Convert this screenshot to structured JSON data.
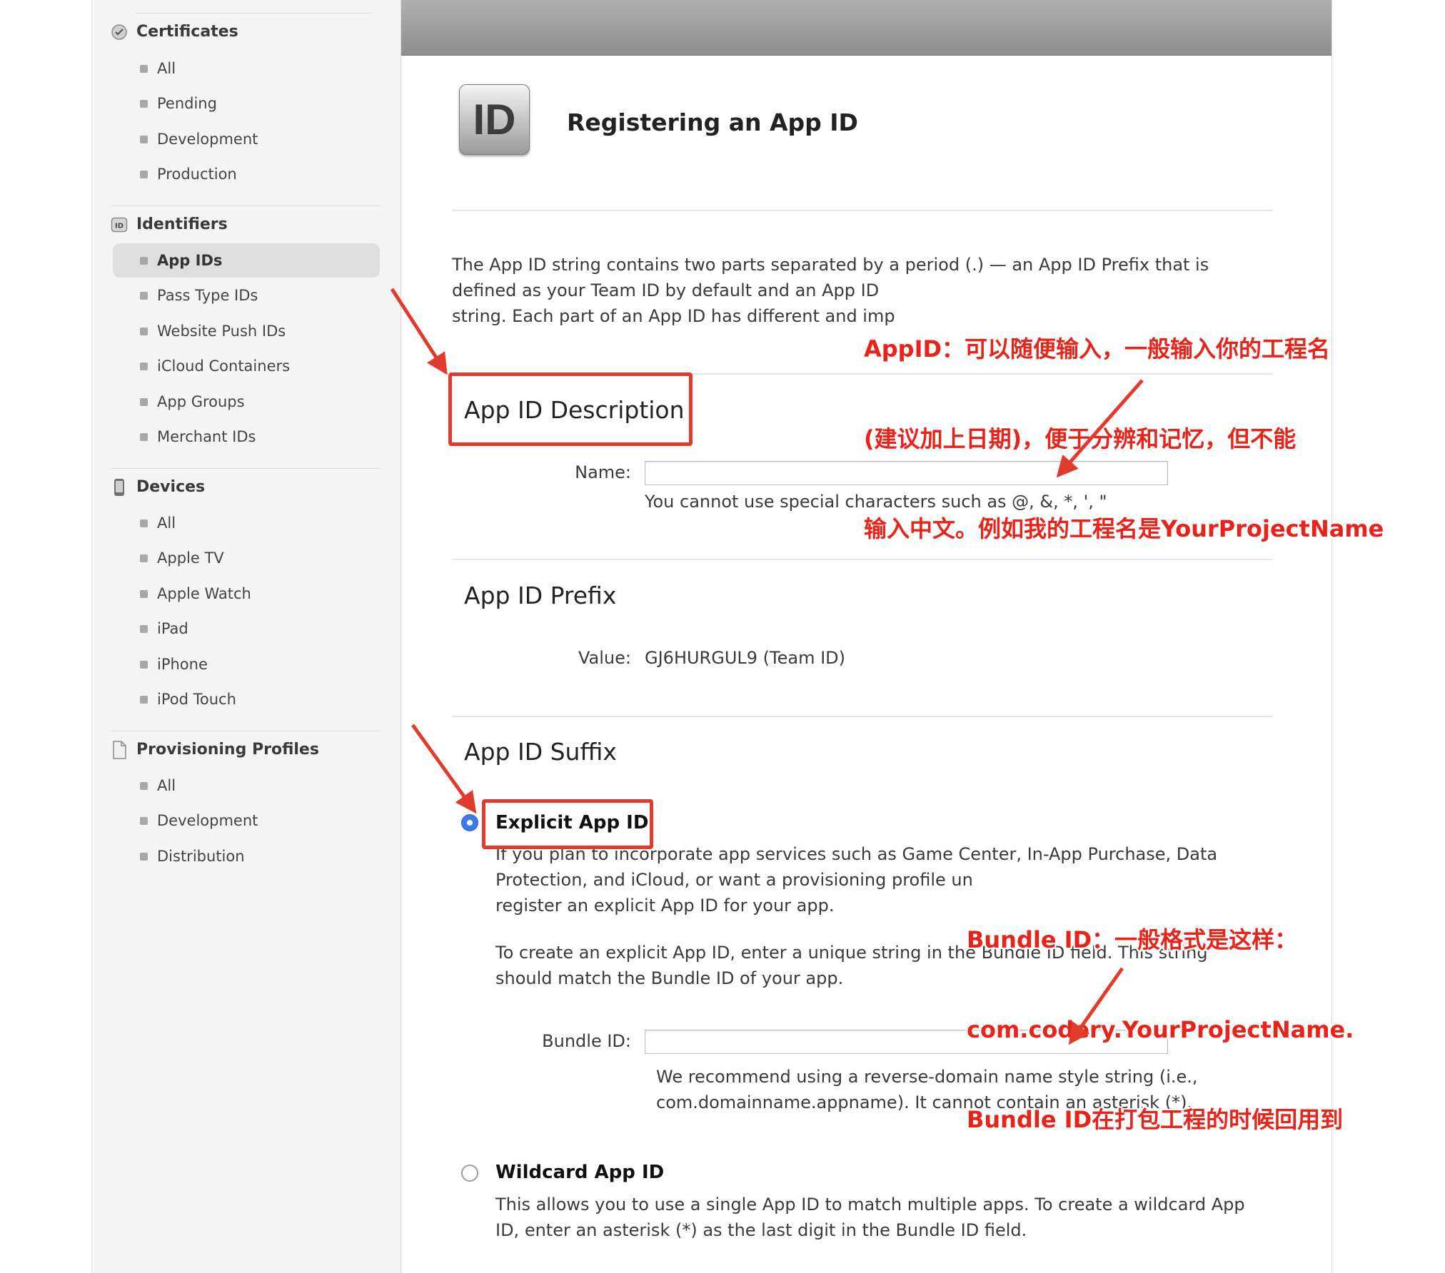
{
  "sidebar": {
    "sections": [
      {
        "title": "Certificates",
        "icon": "certificate-badge-icon",
        "items": [
          "All",
          "Pending",
          "Development",
          "Production"
        ]
      },
      {
        "title": "Identifiers",
        "icon": "id-icon",
        "items": [
          "App IDs",
          "Pass Type IDs",
          "Website Push IDs",
          "iCloud Containers",
          "App Groups",
          "Merchant IDs"
        ],
        "selected": "App IDs"
      },
      {
        "title": "Devices",
        "icon": "device-phone-icon",
        "items": [
          "All",
          "Apple TV",
          "Apple Watch",
          "iPad",
          "iPhone",
          "iPod Touch"
        ]
      },
      {
        "title": "Provisioning Profiles",
        "icon": "document-icon",
        "items": [
          "All",
          "Development",
          "Distribution"
        ]
      }
    ]
  },
  "main": {
    "badge_text": "ID",
    "page_title": "Registering an App ID",
    "intro_lines": [
      "The App ID string contains two parts separated by a period (.) — an App ID Prefix that is",
      "defined as your Team ID by default and an App ID",
      "string. Each part of an App ID has different and imp"
    ],
    "description": {
      "title": "App ID Description",
      "name_label": "Name:",
      "name_value": "",
      "hint": "You cannot use special characters such as @, &, *, ', \""
    },
    "prefix": {
      "title": "App ID Prefix",
      "value_label": "Value:",
      "value": "GJ6HURGUL9 (Team ID)"
    },
    "suffix": {
      "title": "App ID Suffix",
      "explicit": {
        "label": "Explicit App ID",
        "selected": true,
        "desc_lines": [
          "If you plan to incorporate app services such as Game Center, In-App Purchase, Data",
          "Protection, and iCloud, or want a provisioning profile un",
          "register an explicit App ID for your app."
        ],
        "desc2_lines": [
          "To create an explicit App ID, enter a unique string in the Bundle ID field. This string",
          "should match the Bundle ID of your app."
        ],
        "bundle_label": "Bundle ID:",
        "bundle_value": "",
        "bundle_hint_lines": [
          "We recommend using a reverse-domain name style string (i.e.,",
          "com.domainname.appname). It cannot contain an asterisk (*)."
        ]
      },
      "wildcard": {
        "label": "Wildcard App ID",
        "selected": false,
        "desc_lines": [
          "This allows you to use a single App ID to match multiple apps. To create a wildcard App",
          "ID, enter an asterisk (*) as the last digit in the Bundle ID field."
        ]
      }
    }
  },
  "annotations": {
    "appid_note_lines": [
      "AppID：可以随便输入，一般输入你的工程名",
      "(建议加上日期)，便于分辨和记忆，但不能",
      "输入中文。例如我的工程名是YourProjectName"
    ],
    "bundle_note_lines": [
      "Bundle ID：一般格式是这样：",
      "com.codery.YourProjectName.",
      "Bundle ID在打包工程的时候回用到"
    ],
    "color": "#e8231a"
  },
  "colors": {
    "sidebar_bg": "#f4f4f4",
    "radio_selected": "#3d7ae6",
    "annotation_red": "#e23a2d"
  }
}
